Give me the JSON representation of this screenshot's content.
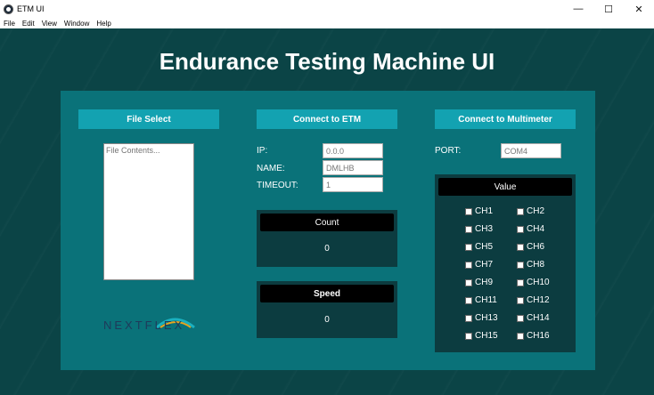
{
  "window": {
    "title": "ETM UI",
    "minimize_glyph": "—",
    "maximize_glyph": "☐",
    "close_glyph": "✕"
  },
  "menu": [
    "File",
    "Edit",
    "View",
    "Window",
    "Help"
  ],
  "app_title": "Endurance Testing Machine UI",
  "file_panel": {
    "button_label": "File Select",
    "textarea_placeholder": "File Contents...",
    "logo_text": "NEXTFLEX"
  },
  "etm_panel": {
    "button_label": "Connect to ETM",
    "fields": [
      {
        "label": "IP:",
        "value": "0.0.0"
      },
      {
        "label": "NAME:",
        "value": "DMLHB"
      },
      {
        "label": "TIMEOUT:",
        "value": "1"
      }
    ],
    "count": {
      "header": "Count",
      "value": "0"
    },
    "speed": {
      "header": "Speed",
      "value": "0"
    }
  },
  "multimeter_panel": {
    "button_label": "Connect to Multimeter",
    "port_label": "PORT:",
    "port_value": "COM4",
    "value_header": "Value",
    "channels": [
      "CH1",
      "CH2",
      "CH3",
      "CH4",
      "CH5",
      "CH6",
      "CH7",
      "CH8",
      "CH9",
      "CH10",
      "CH11",
      "CH12",
      "CH13",
      "CH14",
      "CH15",
      "CH16"
    ]
  },
  "colors": {
    "background": "#0b4446",
    "panel": "#0a7279",
    "button": "#13a2b1",
    "dark_box": "#0c3c40"
  }
}
